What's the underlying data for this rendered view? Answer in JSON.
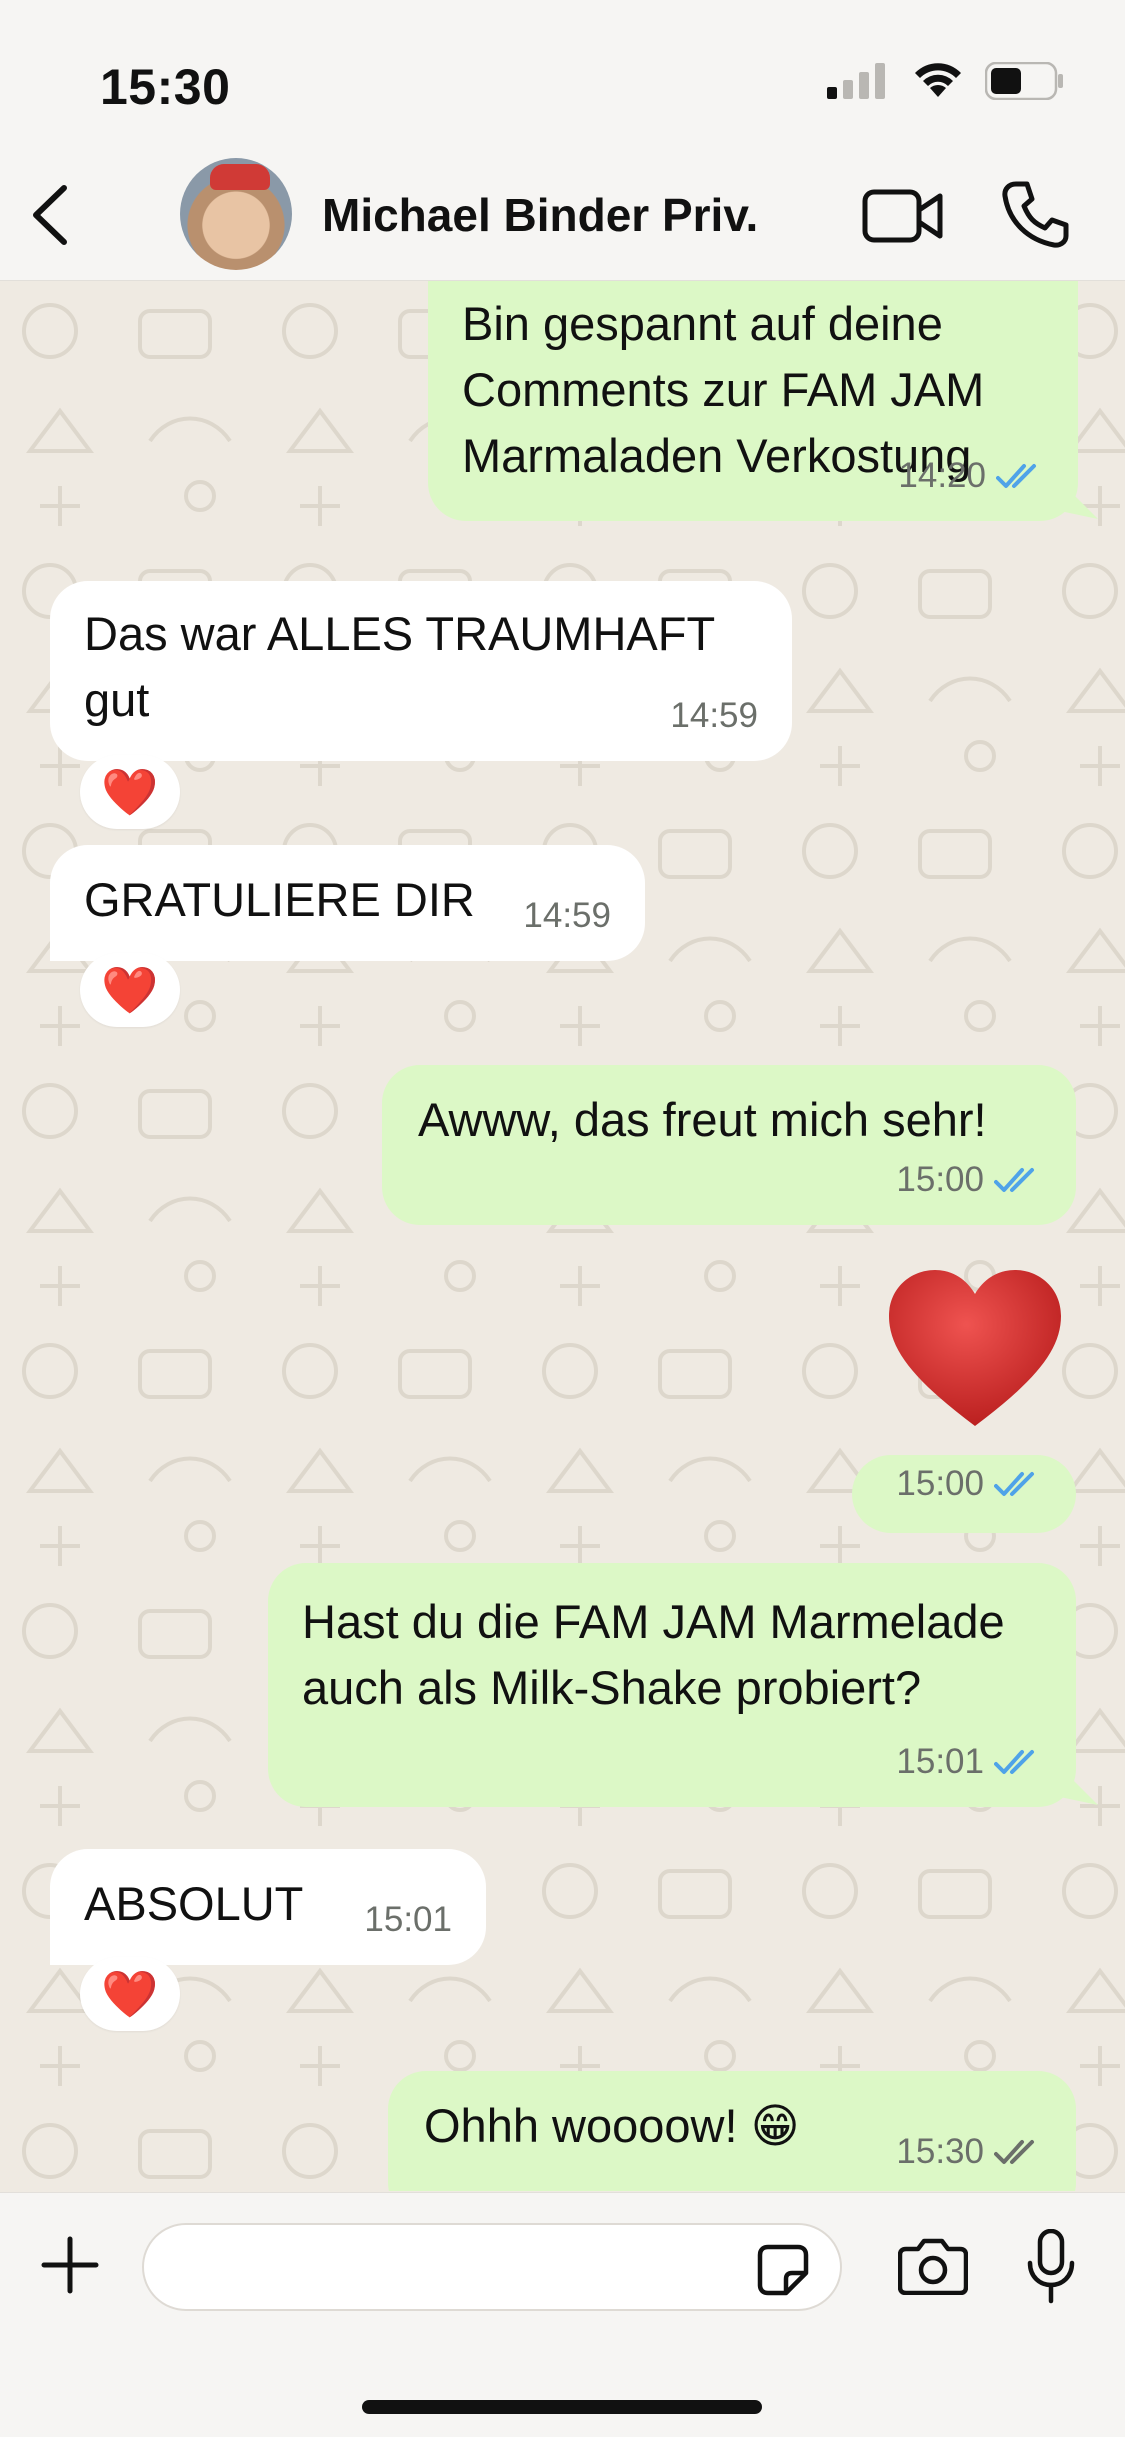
{
  "status_bar": {
    "time": "15:30",
    "icons": [
      "signal-icon",
      "wifi-icon",
      "battery-icon"
    ]
  },
  "header": {
    "back_icon": "chevron-left-icon",
    "contact_name": "Michael Binder Priv.",
    "actions": [
      "video-call-icon",
      "phone-icon"
    ]
  },
  "messages": [
    {
      "direction": "out",
      "text": "Bin gespannt auf deine Comments zur FAM JAM Marmaladen Verkostung",
      "time": "14:20",
      "status": "read"
    },
    {
      "direction": "in",
      "text": "Das war ALLES TRAUMHAFT gut",
      "time": "14:59",
      "reaction": "❤️"
    },
    {
      "direction": "in",
      "text": "GRATULIERE DIR",
      "time": "14:59",
      "reaction": "❤️"
    },
    {
      "direction": "out",
      "text": "Awww, das freut mich sehr!",
      "time": "15:00",
      "status": "read"
    },
    {
      "direction": "out",
      "text": "",
      "emoji": "❤️",
      "time": "15:00",
      "status": "read"
    },
    {
      "direction": "out",
      "text": "Hast du die FAM JAM Marmelade auch als Milk-Shake probiert?",
      "time": "15:01",
      "status": "read"
    },
    {
      "direction": "in",
      "text": "ABSOLUT",
      "time": "15:01",
      "reaction": "❤️"
    },
    {
      "direction": "out",
      "text": "Ohhh woooow! 😁",
      "time": "15:30",
      "status": "delivered"
    }
  ],
  "input": {
    "placeholder": "",
    "icons": [
      "plus-icon",
      "sticker-icon",
      "camera-icon",
      "microphone-icon"
    ]
  },
  "colors": {
    "outgoing_bubble": "#dcf8c6",
    "incoming_bubble": "#ffffff",
    "background": "#efeae2",
    "read_tick": "#4fa3e8",
    "delivered_tick": "#6b6f6a",
    "heart": "#d32f2f"
  }
}
